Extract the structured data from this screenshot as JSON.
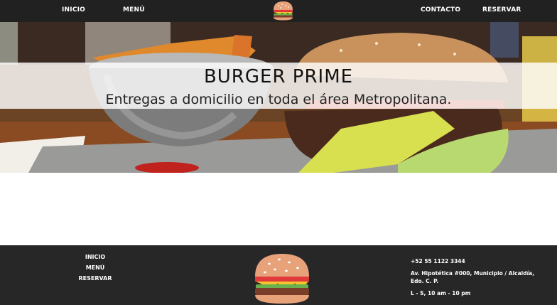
{
  "nav": {
    "inicio": "INICIO",
    "menu": "MENÚ",
    "contacto": "CONTACTO",
    "reservar": "RESERVAR",
    "logo_icon": "burger-icon"
  },
  "hero": {
    "title": "BURGER PRIME",
    "subtitle": "Entregas a domicilio en toda el área Metropolitana."
  },
  "footer": {
    "links": [
      "INICIO",
      "MENÚ",
      "RESERVAR"
    ],
    "phone": "+52 55 1122 3344",
    "address_line1": "Av. Hipotética #000, Municipio / Alcaldía,",
    "address_line2": "Edo. C. P.",
    "hours": "L - S, 10 am - 10 pm",
    "logo_icon": "burger-icon"
  },
  "colors": {
    "nav_bg": "#212121",
    "footer_bg": "#272727",
    "text_light": "#ffffff"
  }
}
